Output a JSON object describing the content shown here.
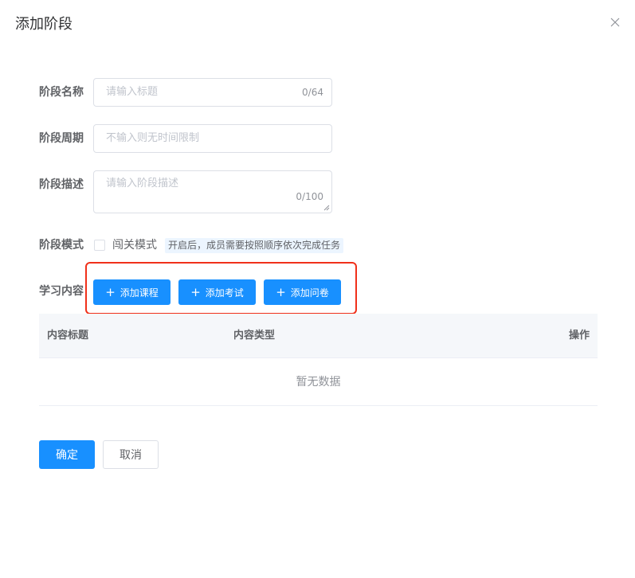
{
  "dialog": {
    "title": "添加阶段",
    "close_icon": "close-icon"
  },
  "form": {
    "name": {
      "label": "阶段名称",
      "placeholder": "请输入标题",
      "value": "",
      "count": "0/64"
    },
    "period": {
      "label": "阶段周期",
      "placeholder": "不输入则无时间限制",
      "value": ""
    },
    "description": {
      "label": "阶段描述",
      "placeholder": "请输入阶段描述",
      "value": "",
      "count": "0/100"
    },
    "mode": {
      "label": "阶段模式",
      "checkbox_label": "闯关模式",
      "checked": false,
      "hint": "开启后，成员需要按照顺序依次完成任务"
    },
    "content": {
      "label": "学习内容",
      "buttons": [
        {
          "icon": "plus-icon",
          "label": "添加课程"
        },
        {
          "icon": "plus-icon",
          "label": "添加考试"
        },
        {
          "icon": "plus-icon",
          "label": "添加问卷"
        }
      ]
    }
  },
  "table": {
    "columns": [
      "内容标题",
      "内容类型",
      "操作"
    ],
    "rows": [],
    "empty_text": "暂无数据"
  },
  "footer": {
    "confirm_label": "确定",
    "cancel_label": "取消"
  },
  "colors": {
    "primary": "#1890ff",
    "highlight": "#f0301a"
  }
}
